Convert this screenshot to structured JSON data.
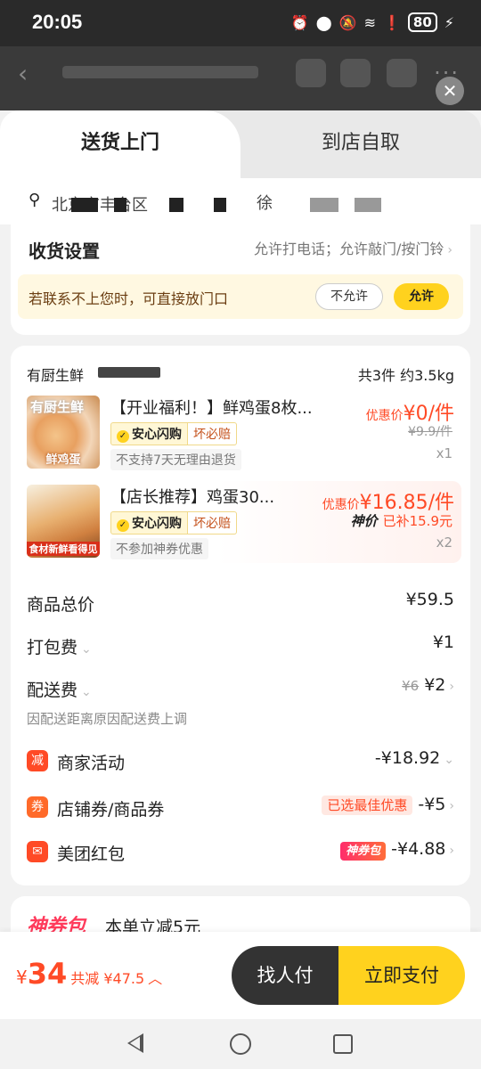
{
  "status_bar": {
    "time": "20:05",
    "battery": "80"
  },
  "tabs": {
    "delivery": "送货上门",
    "pickup": "到店自取"
  },
  "address": {
    "line": "北京市丰台区",
    "name": "徐"
  },
  "settings": {
    "title": "收货设置",
    "options": "允许打电话；允许敲门/按门铃",
    "notice": "若联系不上您时，可直接放门口",
    "deny_label": "不允许",
    "allow_label": "允许"
  },
  "order": {
    "store_name": "有厨生鲜",
    "summary": "共3件 约3.5kg",
    "items": [
      {
        "name": "【开业福利！】鲜鸡蛋8枚...",
        "thumb_top": "有厨生鲜",
        "thumb_caption": "鲜鸡蛋",
        "badge": "安心闪购",
        "badge2": "坏必赔",
        "note": "不支持7天无理由退货",
        "price_label": "优惠价",
        "price": "¥0/件",
        "original": "¥9.9/件",
        "qty": "x1"
      },
      {
        "name": "【店长推荐】鸡蛋30...",
        "thumb_caption": "食材新鲜看得见",
        "badge": "安心闪购",
        "badge2": "坏必赔",
        "note": "不参加神券优惠",
        "price_label": "优惠价",
        "price": "¥16.85/件",
        "subsidy_tag": "神价",
        "subsidy": "已补15.9元",
        "qty": "x2"
      }
    ],
    "rows": {
      "subtotal_label": "商品总价",
      "subtotal": "¥59.5",
      "packing_label": "打包费",
      "packing": "¥1",
      "shipping_label": "配送费",
      "shipping_orig": "¥6",
      "shipping": "¥2",
      "shipping_hint": "因配送距离原因配送费上调",
      "merchant_label": "商家活动",
      "merchant_icon": "减",
      "merchant": "-¥18.92",
      "coupon_label": "店铺券/商品券",
      "coupon_icon": "券",
      "coupon_tag": "已选最佳优惠",
      "coupon": "-¥5",
      "redpack_label": "美团红包",
      "redpack_tag": "神券包",
      "redpack": "-¥4.88"
    }
  },
  "promo": {
    "title": "神券包",
    "desc": "本单立减5元"
  },
  "paybar": {
    "currency": "¥",
    "total": "34",
    "saved": "共减 ¥47.5",
    "find_pay": "找人付",
    "pay_now": "立即支付"
  },
  "colors": {
    "accent": "#ffd21e",
    "price_red": "#ff4a26"
  }
}
